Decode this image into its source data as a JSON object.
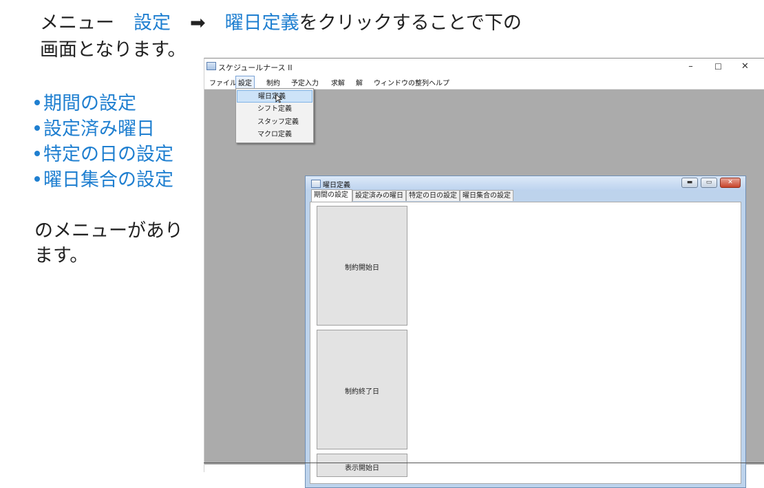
{
  "slide": {
    "line1_menu": "メニュー",
    "line1_setting": "設定",
    "line1_arrow": "➡",
    "line1_target": "曜日定義",
    "line1_rest": "をクリックすることで下の",
    "line2": "画面となります。",
    "bullets": [
      "期間の設定",
      "設定済み曜日",
      "特定の日の設定",
      "曜日集合の設定"
    ],
    "note": "のメニューがあります。"
  },
  "app": {
    "title": "スケジュールナース II",
    "win_min": "–",
    "win_max": "☐",
    "win_close": "✕",
    "menu": [
      "ファイル",
      "設定",
      "制約",
      "予定入力",
      "求解",
      "解",
      "ウィンドウの整列",
      "ヘルプ"
    ],
    "dropdown": [
      "曜日定義",
      "シフト定義",
      "スタッフ定義",
      "マクロ定義"
    ]
  },
  "child": {
    "title": "曜日定義",
    "tabs": [
      "期間の設定",
      "設定済みの曜日",
      "特定の日の設定",
      "曜日集合の設定"
    ],
    "panels": [
      "制約開始日",
      "制約終了日",
      "表示開始日"
    ]
  },
  "colors": {
    "accent": "#1f7fd0",
    "mdi_background": "#ababab",
    "menu_highlight": "#cde3f8"
  },
  "icons": [
    "app-icon",
    "mouse-cursor-icon",
    "minimize-icon",
    "maximize-icon",
    "close-icon"
  ]
}
